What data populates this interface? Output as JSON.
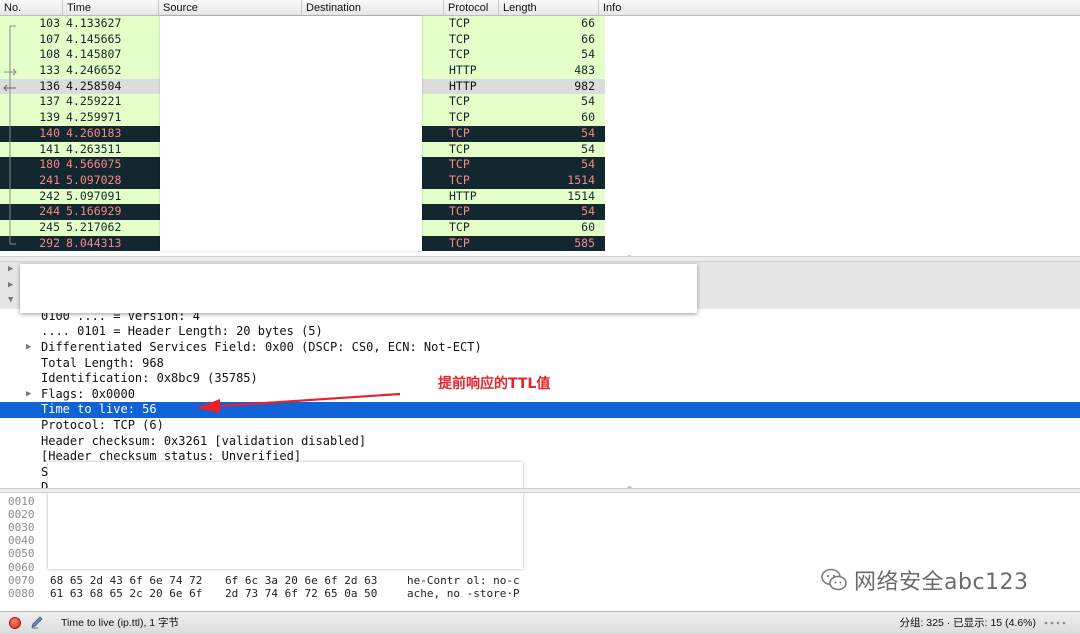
{
  "packet_list": {
    "columns": [
      "No.",
      "Time",
      "Source",
      "Destination",
      "Protocol",
      "Length",
      "Info"
    ],
    "rows": [
      {
        "no": "103",
        "time": "4.133627",
        "protocol": "TCP",
        "length": "66",
        "style": "green"
      },
      {
        "no": "107",
        "time": "4.145665",
        "protocol": "TCP",
        "length": "66",
        "style": "green"
      },
      {
        "no": "108",
        "time": "4.145807",
        "protocol": "TCP",
        "length": "54",
        "style": "green"
      },
      {
        "no": "133",
        "time": "4.246652",
        "protocol": "HTTP",
        "length": "483",
        "style": "green"
      },
      {
        "no": "136",
        "time": "4.258504",
        "protocol": "HTTP",
        "length": "982",
        "style": "selected"
      },
      {
        "no": "137",
        "time": "4.259221",
        "protocol": "TCP",
        "length": "54",
        "style": "green"
      },
      {
        "no": "139",
        "time": "4.259971",
        "protocol": "TCP",
        "length": "60",
        "style": "green"
      },
      {
        "no": "140",
        "time": "4.260183",
        "protocol": "TCP",
        "length": "54",
        "style": "dark"
      },
      {
        "no": "141",
        "time": "4.263511",
        "protocol": "TCP",
        "length": "54",
        "style": "green"
      },
      {
        "no": "180",
        "time": "4.566075",
        "protocol": "TCP",
        "length": "54",
        "style": "dark"
      },
      {
        "no": "241",
        "time": "5.097028",
        "protocol": "TCP",
        "length": "1514",
        "style": "dark"
      },
      {
        "no": "242",
        "time": "5.097091",
        "protocol": "HTTP",
        "length": "1514",
        "style": "green"
      },
      {
        "no": "244",
        "time": "5.166929",
        "protocol": "TCP",
        "length": "54",
        "style": "dark"
      },
      {
        "no": "245",
        "time": "5.217062",
        "protocol": "TCP",
        "length": "60",
        "style": "green"
      },
      {
        "no": "292",
        "time": "8.044313",
        "protocol": "TCP",
        "length": "585",
        "style": "dark"
      }
    ]
  },
  "details": {
    "lines": [
      {
        "text": "0100 .... = Version: 4",
        "expander": false
      },
      {
        "text": ".... 0101 = Header Length: 20 bytes (5)",
        "expander": false
      },
      {
        "text": "Differentiated Services Field: 0x00 (DSCP: CS0, ECN: Not-ECT)",
        "expander": true
      },
      {
        "text": "Total Length: 968",
        "expander": false
      },
      {
        "text": "Identification: 0x8bc9 (35785)",
        "expander": false
      },
      {
        "text": "Flags: 0x0000",
        "expander": true
      },
      {
        "text": "Time to live: 56",
        "expander": false,
        "selected": true
      },
      {
        "text": "Protocol: TCP (6)",
        "expander": false
      },
      {
        "text": "Header checksum: 0x3261 [validation disabled]",
        "expander": false
      },
      {
        "text": "[Header checksum status: Unverified]",
        "expander": false
      },
      {
        "text": "S",
        "expander": false
      },
      {
        "text": "D",
        "expander": false
      }
    ],
    "annotation": "提前响应的TTL值",
    "annotation_color": "#e8222a"
  },
  "bytes": {
    "rows": [
      {
        "offset": "0010",
        "hex1": "",
        "hex2": "",
        "ascii": ""
      },
      {
        "offset": "0020",
        "hex1": "",
        "hex2": "",
        "ascii": ""
      },
      {
        "offset": "0030",
        "hex1": "",
        "hex2": "",
        "ascii": "2"
      },
      {
        "offset": "0040",
        "hex1": "",
        "hex2": "",
        "ascii": "7"
      },
      {
        "offset": "0050",
        "hex1": "",
        "hex2": "",
        "ascii": "x"
      },
      {
        "offset": "0060",
        "hex1": "",
        "hex2": "",
        "ascii": ""
      },
      {
        "offset": "0070",
        "hex1": "68 65 2d 43 6f 6e 74 72",
        "hex2": "6f 6c 3a 20 6e 6f 2d 63",
        "ascii": "he-Contr ol: no-c"
      },
      {
        "offset": "0080",
        "hex1": "61 63 68 65 2c 20 6e 6f",
        "hex2": "2d 73 74 6f 72 65 0a 50",
        "ascii": "ache, no -store·P"
      }
    ]
  },
  "watermark": {
    "text": "网络安全abc123",
    "icon": "wechat-icon"
  },
  "statusbar": {
    "field_info": "Time to live (ip.ttl), 1 字节",
    "counts": "分组: 325 · 已显示: 15 (4.6%)"
  },
  "colors": {
    "row_green": "#e4ffc7",
    "row_dark": "#12272e",
    "row_dark_text": "#f78787",
    "selection_blue": "#0f63d6"
  }
}
